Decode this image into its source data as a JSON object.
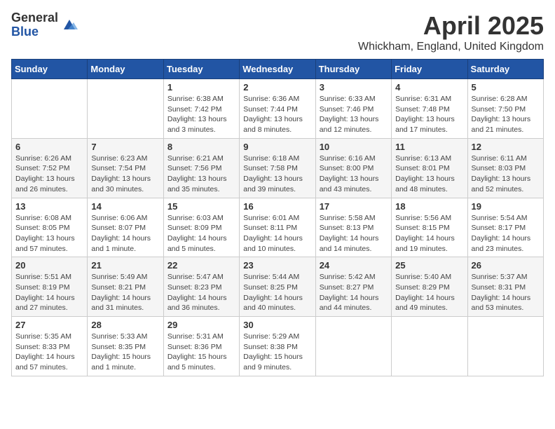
{
  "logo": {
    "general": "General",
    "blue": "Blue"
  },
  "header": {
    "title": "April 2025",
    "location": "Whickham, England, United Kingdom"
  },
  "weekdays": [
    "Sunday",
    "Monday",
    "Tuesday",
    "Wednesday",
    "Thursday",
    "Friday",
    "Saturday"
  ],
  "weeks": [
    [
      {
        "day": "",
        "info": ""
      },
      {
        "day": "",
        "info": ""
      },
      {
        "day": "1",
        "info": "Sunrise: 6:38 AM\nSunset: 7:42 PM\nDaylight: 13 hours\nand 3 minutes."
      },
      {
        "day": "2",
        "info": "Sunrise: 6:36 AM\nSunset: 7:44 PM\nDaylight: 13 hours\nand 8 minutes."
      },
      {
        "day": "3",
        "info": "Sunrise: 6:33 AM\nSunset: 7:46 PM\nDaylight: 13 hours\nand 12 minutes."
      },
      {
        "day": "4",
        "info": "Sunrise: 6:31 AM\nSunset: 7:48 PM\nDaylight: 13 hours\nand 17 minutes."
      },
      {
        "day": "5",
        "info": "Sunrise: 6:28 AM\nSunset: 7:50 PM\nDaylight: 13 hours\nand 21 minutes."
      }
    ],
    [
      {
        "day": "6",
        "info": "Sunrise: 6:26 AM\nSunset: 7:52 PM\nDaylight: 13 hours\nand 26 minutes."
      },
      {
        "day": "7",
        "info": "Sunrise: 6:23 AM\nSunset: 7:54 PM\nDaylight: 13 hours\nand 30 minutes."
      },
      {
        "day": "8",
        "info": "Sunrise: 6:21 AM\nSunset: 7:56 PM\nDaylight: 13 hours\nand 35 minutes."
      },
      {
        "day": "9",
        "info": "Sunrise: 6:18 AM\nSunset: 7:58 PM\nDaylight: 13 hours\nand 39 minutes."
      },
      {
        "day": "10",
        "info": "Sunrise: 6:16 AM\nSunset: 8:00 PM\nDaylight: 13 hours\nand 43 minutes."
      },
      {
        "day": "11",
        "info": "Sunrise: 6:13 AM\nSunset: 8:01 PM\nDaylight: 13 hours\nand 48 minutes."
      },
      {
        "day": "12",
        "info": "Sunrise: 6:11 AM\nSunset: 8:03 PM\nDaylight: 13 hours\nand 52 minutes."
      }
    ],
    [
      {
        "day": "13",
        "info": "Sunrise: 6:08 AM\nSunset: 8:05 PM\nDaylight: 13 hours\nand 57 minutes."
      },
      {
        "day": "14",
        "info": "Sunrise: 6:06 AM\nSunset: 8:07 PM\nDaylight: 14 hours\nand 1 minute."
      },
      {
        "day": "15",
        "info": "Sunrise: 6:03 AM\nSunset: 8:09 PM\nDaylight: 14 hours\nand 5 minutes."
      },
      {
        "day": "16",
        "info": "Sunrise: 6:01 AM\nSunset: 8:11 PM\nDaylight: 14 hours\nand 10 minutes."
      },
      {
        "day": "17",
        "info": "Sunrise: 5:58 AM\nSunset: 8:13 PM\nDaylight: 14 hours\nand 14 minutes."
      },
      {
        "day": "18",
        "info": "Sunrise: 5:56 AM\nSunset: 8:15 PM\nDaylight: 14 hours\nand 19 minutes."
      },
      {
        "day": "19",
        "info": "Sunrise: 5:54 AM\nSunset: 8:17 PM\nDaylight: 14 hours\nand 23 minutes."
      }
    ],
    [
      {
        "day": "20",
        "info": "Sunrise: 5:51 AM\nSunset: 8:19 PM\nDaylight: 14 hours\nand 27 minutes."
      },
      {
        "day": "21",
        "info": "Sunrise: 5:49 AM\nSunset: 8:21 PM\nDaylight: 14 hours\nand 31 minutes."
      },
      {
        "day": "22",
        "info": "Sunrise: 5:47 AM\nSunset: 8:23 PM\nDaylight: 14 hours\nand 36 minutes."
      },
      {
        "day": "23",
        "info": "Sunrise: 5:44 AM\nSunset: 8:25 PM\nDaylight: 14 hours\nand 40 minutes."
      },
      {
        "day": "24",
        "info": "Sunrise: 5:42 AM\nSunset: 8:27 PM\nDaylight: 14 hours\nand 44 minutes."
      },
      {
        "day": "25",
        "info": "Sunrise: 5:40 AM\nSunset: 8:29 PM\nDaylight: 14 hours\nand 49 minutes."
      },
      {
        "day": "26",
        "info": "Sunrise: 5:37 AM\nSunset: 8:31 PM\nDaylight: 14 hours\nand 53 minutes."
      }
    ],
    [
      {
        "day": "27",
        "info": "Sunrise: 5:35 AM\nSunset: 8:33 PM\nDaylight: 14 hours\nand 57 minutes."
      },
      {
        "day": "28",
        "info": "Sunrise: 5:33 AM\nSunset: 8:35 PM\nDaylight: 15 hours\nand 1 minute."
      },
      {
        "day": "29",
        "info": "Sunrise: 5:31 AM\nSunset: 8:36 PM\nDaylight: 15 hours\nand 5 minutes."
      },
      {
        "day": "30",
        "info": "Sunrise: 5:29 AM\nSunset: 8:38 PM\nDaylight: 15 hours\nand 9 minutes."
      },
      {
        "day": "",
        "info": ""
      },
      {
        "day": "",
        "info": ""
      },
      {
        "day": "",
        "info": ""
      }
    ]
  ]
}
